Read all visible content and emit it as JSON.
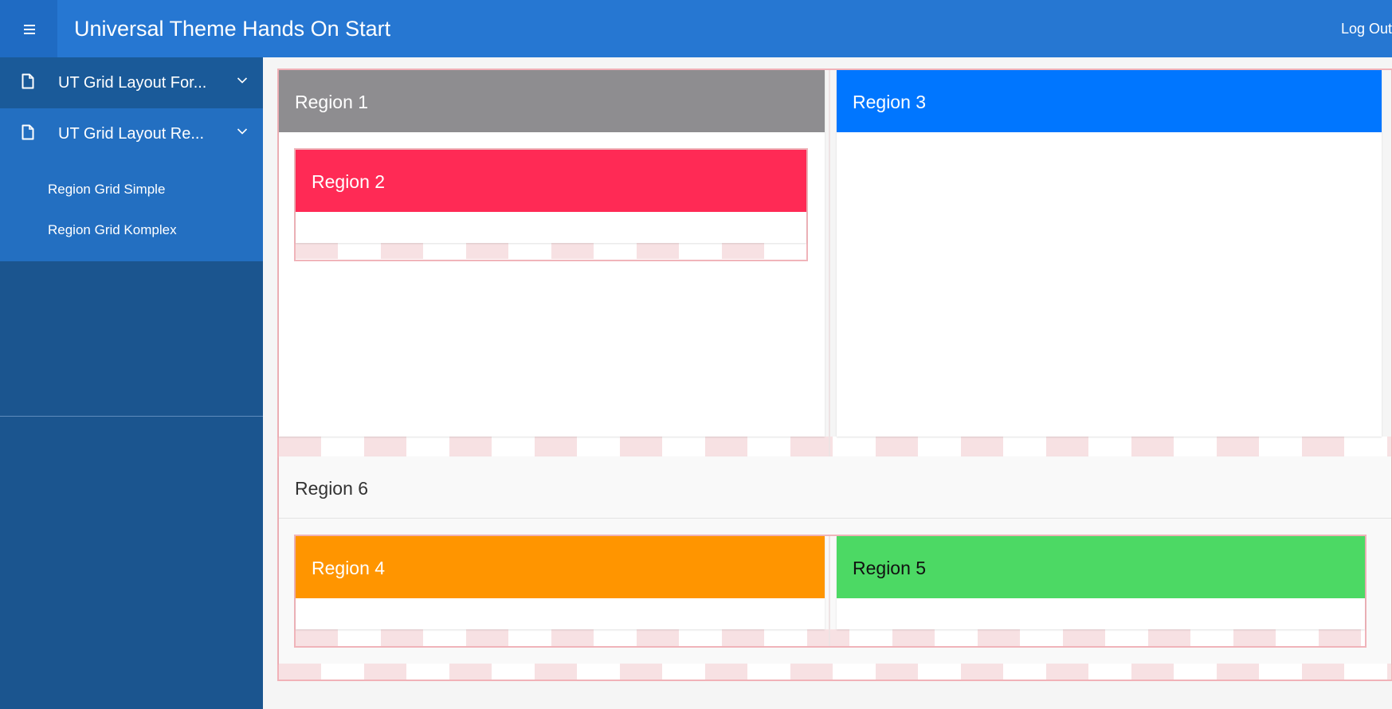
{
  "header": {
    "app_title": "Universal Theme Hands On Start",
    "logout_label": "Log Out",
    "menu_icon": "hamburger-menu-icon",
    "color": "#2677d2"
  },
  "sidebar": {
    "items": [
      {
        "label": "UT Grid Layout For...",
        "icon": "document-icon",
        "expand_icon": "chevron-down-icon"
      },
      {
        "label": "UT Grid Layout Re...",
        "icon": "document-icon",
        "expand_icon": "chevron-down-icon"
      }
    ],
    "subitems": [
      {
        "label": "Region Grid Simple"
      },
      {
        "label": "Region Grid Komplex"
      }
    ]
  },
  "regions": {
    "region1": {
      "title": "Region 1",
      "color": "#8e8d90"
    },
    "region2": {
      "title": "Region 2",
      "color": "#ff2a55"
    },
    "region3": {
      "title": "Region 3",
      "color": "#0076ff"
    },
    "region4": {
      "title": "Region 4",
      "color": "#ff9500"
    },
    "region5": {
      "title": "Region 5",
      "color": "#4cd964"
    },
    "region6": {
      "title": "Region 6"
    }
  }
}
